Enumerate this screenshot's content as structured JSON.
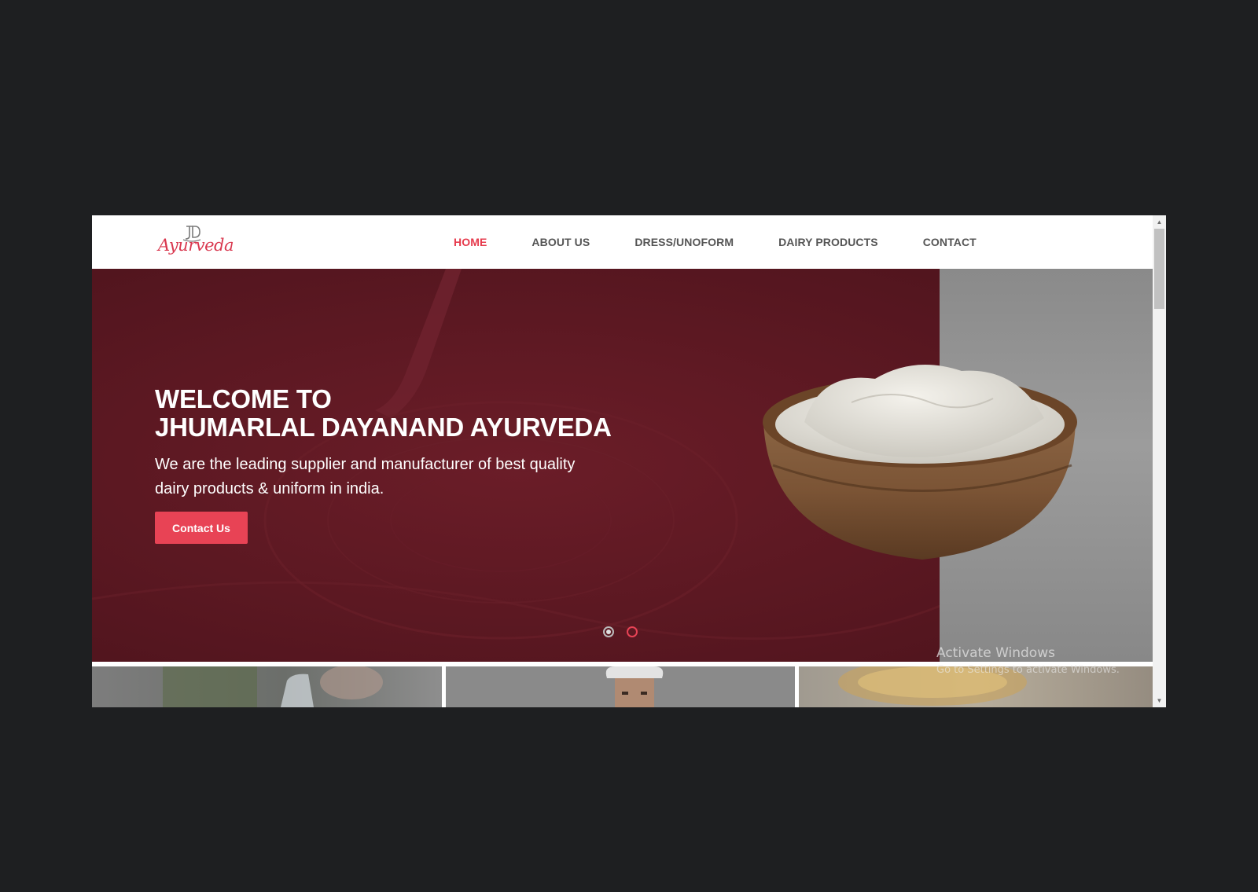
{
  "header": {
    "logo": {
      "monogram": "JD",
      "wordmark": "Ayurveda"
    },
    "nav": [
      {
        "label": "HOME",
        "active": true
      },
      {
        "label": "ABOUT US",
        "active": false
      },
      {
        "label": "DRESS/UNOFORM",
        "active": false
      },
      {
        "label": "DAIRY PRODUCTS",
        "active": false
      },
      {
        "label": "CONTACT",
        "active": false
      }
    ]
  },
  "hero": {
    "title_line1": "WELCOME TO",
    "title_line2": "JHUMARLAL DAYANAND AYURVEDA",
    "subtitle": "We are the leading supplier and manufacturer of best quality dairy products & uniform in india.",
    "cta_label": "Contact Us",
    "slides": 2,
    "active_slide": 1
  },
  "watermark": {
    "title": "Activate Windows",
    "subtitle": "Go to Settings to activate Windows."
  },
  "colors": {
    "accent": "#e84355",
    "hero_bg": "#5f1a24",
    "nav_text": "#555555",
    "page_bg": "#1e1f21"
  },
  "icons": {
    "scroll_up": "arrow-up-icon",
    "scroll_down": "arrow-down-icon",
    "logo_mark": "jd-monogram-icon"
  }
}
